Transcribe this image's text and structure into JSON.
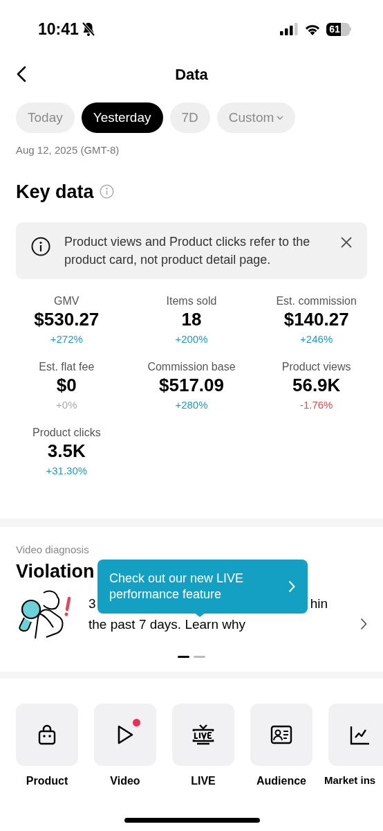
{
  "status_bar": {
    "time": "10:41",
    "battery": "61"
  },
  "header": {
    "title": "Data"
  },
  "tabs": [
    {
      "label": "Today",
      "selected": false,
      "dropdown": false
    },
    {
      "label": "Yesterday",
      "selected": true,
      "dropdown": false
    },
    {
      "label": "7D",
      "selected": false,
      "dropdown": false
    },
    {
      "label": "Custom",
      "selected": false,
      "dropdown": true
    }
  ],
  "date": "Aug 12, 2025 (GMT-8)",
  "key_data": {
    "title": "Key data",
    "notice": "Product views and Product clicks refer to the product card, not product detail page.",
    "metrics": [
      {
        "label": "GMV",
        "value": "$530.27",
        "change": "+272%",
        "color": "#1a9bbf"
      },
      {
        "label": "Items sold",
        "value": "18",
        "change": "+200%",
        "color": "#1a9bbf"
      },
      {
        "label": "Est. commission",
        "value": "$140.27",
        "change": "+246%",
        "color": "#1a9bbf"
      },
      {
        "label": "Est. flat fee",
        "value": "$0",
        "change": "+0%",
        "color": "#aaaaaa"
      },
      {
        "label": "Commission base",
        "value": "$517.09",
        "change": "+280%",
        "color": "#1a9bbf"
      },
      {
        "label": "Product views",
        "value": "56.9K",
        "change": "-1.76%",
        "color": "#e5473f"
      },
      {
        "label": "Product clicks",
        "value": "3.5K",
        "change": "+31.30%",
        "color": "#1a9bbf"
      }
    ]
  },
  "video_diagnosis": {
    "label": "Video diagnosis",
    "title": "Violation",
    "line_1_start": "3",
    "line_1_end": "hin",
    "line_2": "the past 7 days. Learn why",
    "pages": [
      {
        "selected": true
      },
      {
        "selected": false
      }
    ]
  },
  "tooltip": {
    "text": "Check out our new LIVE performance feature"
  },
  "shortcuts": [
    {
      "label": "Product",
      "kind": "bag",
      "badge": false
    },
    {
      "label": "Video",
      "kind": "play",
      "badge": true
    },
    {
      "label": "LIVE",
      "kind": "tv",
      "badge": false
    },
    {
      "label": "Audience",
      "kind": "card",
      "badge": false
    },
    {
      "label": "Market ins",
      "kind": "chart",
      "badge": false
    }
  ]
}
